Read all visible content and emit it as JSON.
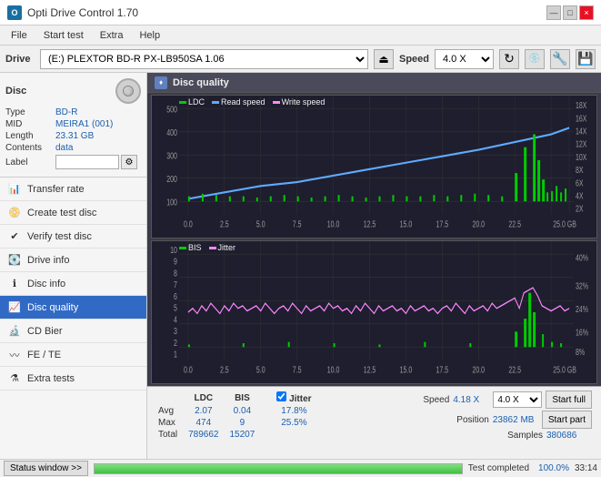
{
  "titleBar": {
    "title": "Opti Drive Control 1.70",
    "icon": "O",
    "controls": [
      "—",
      "□",
      "×"
    ]
  },
  "menuBar": {
    "items": [
      "File",
      "Start test",
      "Extra",
      "Help"
    ]
  },
  "driveToolbar": {
    "driveLabel": "Drive",
    "driveValue": "(E:)  PLEXTOR BD-R  PX-LB950SA 1.06",
    "speedLabel": "Speed",
    "speedValue": "4.0 X"
  },
  "discPanel": {
    "title": "Disc",
    "rows": [
      {
        "label": "Type",
        "value": "BD-R"
      },
      {
        "label": "MID",
        "value": "MEIRA1 (001)"
      },
      {
        "label": "Length",
        "value": "23.31 GB"
      },
      {
        "label": "Contents",
        "value": "data"
      },
      {
        "label": "Label",
        "value": ""
      }
    ]
  },
  "navItems": [
    {
      "id": "transfer-rate",
      "label": "Transfer rate",
      "active": false
    },
    {
      "id": "create-test-disc",
      "label": "Create test disc",
      "active": false
    },
    {
      "id": "verify-test-disc",
      "label": "Verify test disc",
      "active": false
    },
    {
      "id": "drive-info",
      "label": "Drive info",
      "active": false
    },
    {
      "id": "disc-info",
      "label": "Disc info",
      "active": false
    },
    {
      "id": "disc-quality",
      "label": "Disc quality",
      "active": true
    },
    {
      "id": "cd-bier",
      "label": "CD Bier",
      "active": false
    },
    {
      "id": "fe-te",
      "label": "FE / TE",
      "active": false
    },
    {
      "id": "extra-tests",
      "label": "Extra tests",
      "active": false
    }
  ],
  "chartHeader": {
    "title": "Disc quality",
    "icon": "♦"
  },
  "chart1": {
    "title": "LDC chart",
    "legend": [
      {
        "label": "LDC",
        "color": "#00cc00"
      },
      {
        "label": "Read speed",
        "color": "#60aaff"
      },
      {
        "label": "Write speed",
        "color": "#ff88ff"
      }
    ],
    "yAxisLeft": [
      "500",
      "400",
      "300",
      "200",
      "100",
      "0"
    ],
    "yAxisRight": [
      "18X",
      "16X",
      "14X",
      "12X",
      "10X",
      "8X",
      "6X",
      "4X",
      "2X"
    ],
    "xAxis": [
      "0.0",
      "2.5",
      "5.0",
      "7.5",
      "10.0",
      "12.5",
      "15.0",
      "17.5",
      "20.0",
      "22.5",
      "25.0 GB"
    ]
  },
  "chart2": {
    "title": "BIS chart",
    "legend": [
      {
        "label": "BIS",
        "color": "#00cc00"
      },
      {
        "label": "Jitter",
        "color": "#ff88ff"
      }
    ],
    "yAxisLeft": [
      "10",
      "9",
      "8",
      "7",
      "6",
      "5",
      "4",
      "3",
      "2",
      "1"
    ],
    "yAxisRight": [
      "40%",
      "32%",
      "24%",
      "16%",
      "8%"
    ],
    "xAxis": [
      "0.0",
      "2.5",
      "5.0",
      "7.5",
      "10.0",
      "12.5",
      "15.0",
      "17.5",
      "20.0",
      "22.5",
      "25.0 GB"
    ]
  },
  "statsTable": {
    "headers": [
      "",
      "LDC",
      "BIS",
      "",
      "Jitter",
      "Speed",
      ""
    ],
    "rows": [
      {
        "label": "Avg",
        "ldc": "2.07",
        "bis": "0.04",
        "jitter": "17.8%",
        "speed": "4.18 X",
        "speedSelect": "4.0 X"
      },
      {
        "label": "Max",
        "ldc": "474",
        "bis": "9",
        "jitter": "25.5%",
        "position": "23862 MB"
      },
      {
        "label": "Total",
        "ldc": "789662",
        "bis": "15207",
        "samples": "380686"
      }
    ],
    "jitterChecked": true,
    "buttons": {
      "startFull": "Start full",
      "startPart": "Start part"
    }
  },
  "statusBar": {
    "windowBtn": "Status window >>",
    "progress": "100.0%",
    "progressValue": 100,
    "statusText": "Test completed",
    "time": "33:14"
  }
}
